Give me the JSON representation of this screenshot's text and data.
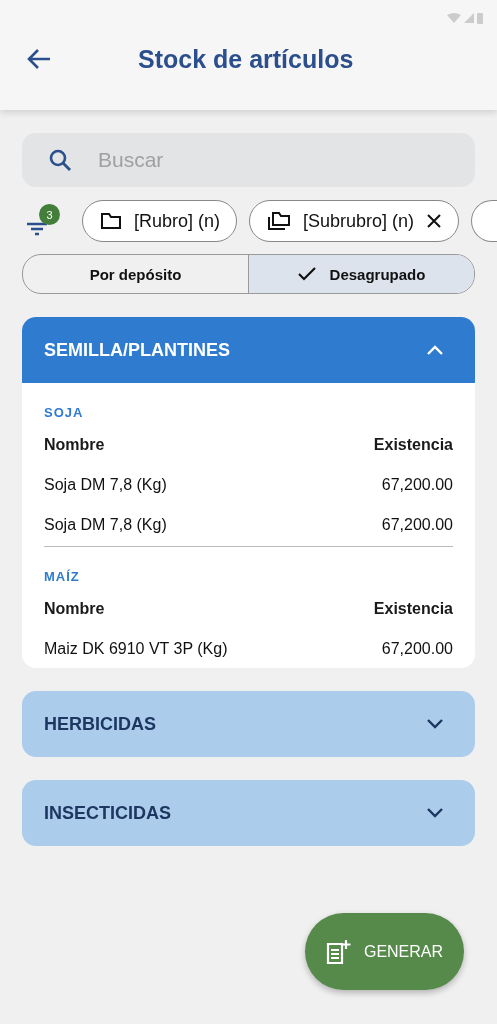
{
  "app_bar": {
    "title": "Stock de artículos"
  },
  "search": {
    "placeholder": "Buscar"
  },
  "filter": {
    "count": "3"
  },
  "chips": [
    {
      "kind": "folder",
      "label": "[Rubro] (n)",
      "removable": false
    },
    {
      "kind": "folders",
      "label": "[Subrubro] (n)",
      "removable": true
    }
  ],
  "segments": [
    {
      "label": "Por depósito",
      "selected": false
    },
    {
      "label": "Desagrupado",
      "selected": true
    }
  ],
  "sections": [
    {
      "title": "SEMILLA/PLANTINES",
      "expanded": true,
      "groups": [
        {
          "name": "SOJA",
          "columns": [
            "Nombre",
            "Existencia"
          ],
          "rows": [
            [
              "Soja DM 7,8 (Kg)",
              "67,200.00"
            ],
            [
              "Soja DM 7,8 (Kg)",
              "67,200.00"
            ]
          ]
        },
        {
          "name": "MAÍZ",
          "columns": [
            "Nombre",
            "Existencia"
          ],
          "rows": [
            [
              "Maiz DK 6910 VT 3P (Kg)",
              "67,200.00"
            ]
          ]
        }
      ]
    },
    {
      "title": "HERBICIDAS",
      "expanded": false
    },
    {
      "title": "INSECTICIDAS",
      "expanded": false
    }
  ],
  "fab": {
    "label": "GENERAR"
  }
}
